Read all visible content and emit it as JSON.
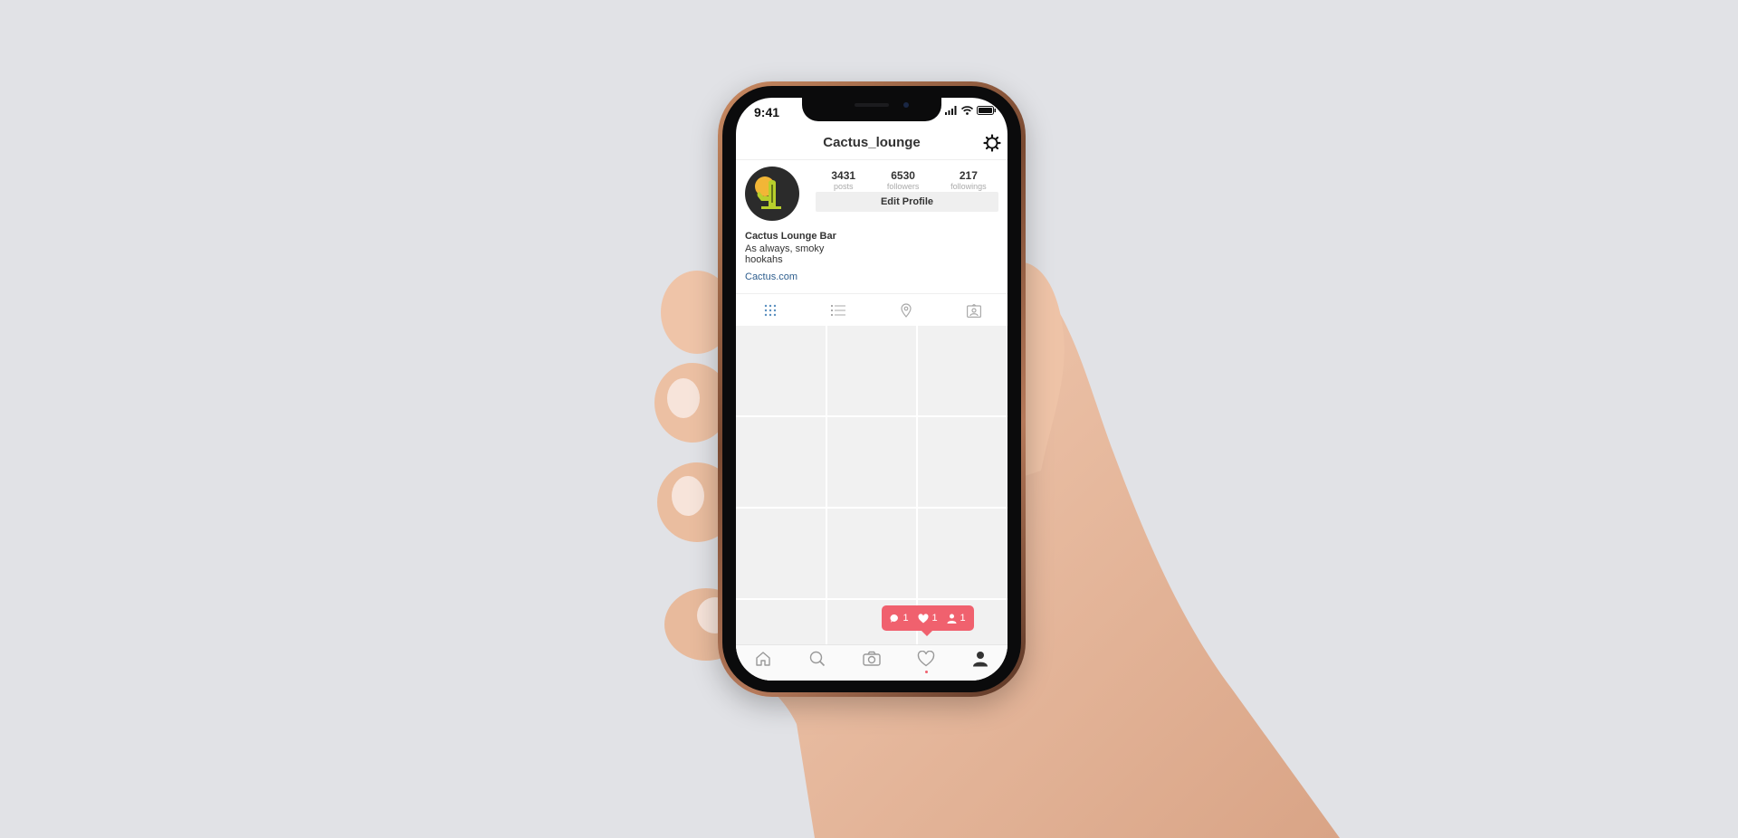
{
  "status_bar": {
    "time": "9:41"
  },
  "profile": {
    "username": "Cactus_lounge",
    "stats": [
      {
        "value": "3431",
        "label": "posts"
      },
      {
        "value": "6530",
        "label": "followers"
      },
      {
        "value": "217",
        "label": "followings"
      }
    ],
    "edit_label": "Edit Profile",
    "display_name": "Cactus Lounge Bar",
    "bio": "As always, smoky hookahs",
    "website": "Cactus.com"
  },
  "tabs": [
    {
      "icon": "grid-icon",
      "active": true
    },
    {
      "icon": "list-icon",
      "active": false
    },
    {
      "icon": "location-pin-icon",
      "active": false
    },
    {
      "icon": "tagged-photos-icon",
      "active": false
    }
  ],
  "notifications": {
    "comments": "1",
    "likes": "1",
    "followers": "1"
  },
  "tabbar": [
    {
      "icon": "home-icon"
    },
    {
      "icon": "search-icon"
    },
    {
      "icon": "camera-icon"
    },
    {
      "icon": "heart-icon"
    },
    {
      "icon": "profile-icon"
    }
  ],
  "colors": {
    "background": "#e1e2e6",
    "accent": "#f0616e",
    "link": "#2e5e8e",
    "active_tab": "#5a8fbf"
  }
}
